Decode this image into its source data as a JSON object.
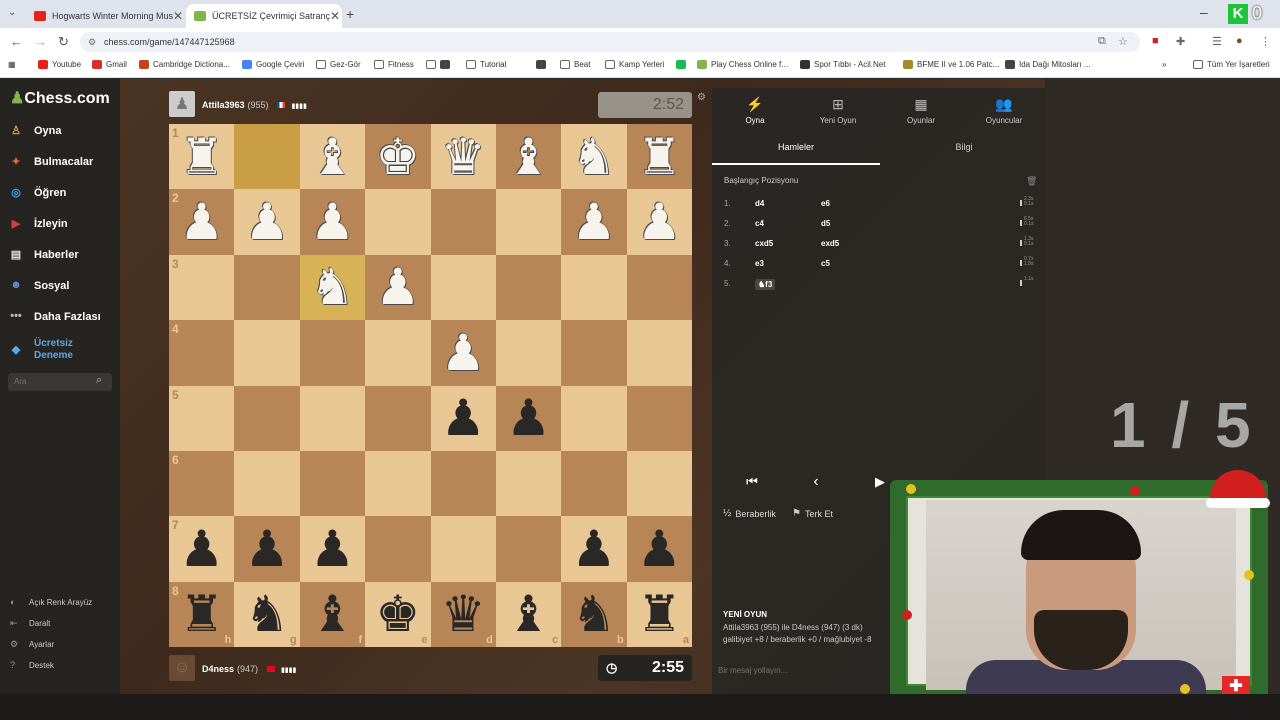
{
  "browser": {
    "tabs": [
      {
        "title": "Hogwarts Winter Morning Mus",
        "favicon_color": "#e62117",
        "active": false
      },
      {
        "title": "ÜCRETSİZ Çevrimiçi Satranç",
        "favicon_color": "#81b64c",
        "active": true
      }
    ],
    "url": "chess.com/game/147447125968",
    "bookmarks": [
      {
        "label": "Youtube",
        "icon": "youtube-icon",
        "color": "#e62117"
      },
      {
        "label": "Gmail",
        "icon": "gmail-icon",
        "color": "#d93025"
      },
      {
        "label": "Cambridge Dictiona...",
        "icon": "cambridge-icon",
        "color": "#c7421a"
      },
      {
        "label": "Google Çeviri",
        "icon": "translate-icon",
        "color": "#4285f4"
      },
      {
        "label": "Gez-Gör",
        "icon": "folder-icon",
        "color": ""
      },
      {
        "label": "Fitness",
        "icon": "folder-icon",
        "color": ""
      },
      {
        "label": "",
        "icon": "folder-icon",
        "color": ""
      },
      {
        "label": "",
        "icon": "music-icon",
        "color": "#444"
      },
      {
        "label": "Tutorial",
        "icon": "folder-icon",
        "color": ""
      },
      {
        "label": "",
        "icon": "gallery-icon",
        "color": "#444"
      },
      {
        "label": "Beat",
        "icon": "folder-icon",
        "color": ""
      },
      {
        "label": "Kamp Yerleri",
        "icon": "folder-icon",
        "color": ""
      },
      {
        "label": "",
        "icon": "spotify-icon",
        "color": "#1db954"
      },
      {
        "label": "Play Chess Online f...",
        "icon": "chess-icon",
        "color": "#81b64c"
      },
      {
        "label": "Spor Tıbbı - Acil.Net",
        "icon": "globe-icon",
        "color": "#333"
      },
      {
        "label": "BFME II ve 1.06 Patc...",
        "icon": "bfme-icon",
        "color": "#a38b2e"
      },
      {
        "label": "Ida Dağı Mitosları ...",
        "icon": "doc-icon",
        "color": "#444"
      }
    ],
    "bookmarks_more": "»",
    "all_bookmarks": "Tüm Yer İşaretleri"
  },
  "sidebar": {
    "logo": "Chess.com",
    "items": [
      {
        "label": "Oyna",
        "icon": "play-icon",
        "color": "#e0a04b"
      },
      {
        "label": "Bulmacalar",
        "icon": "puzzle-icon",
        "color": "#e06a3b"
      },
      {
        "label": "Öğren",
        "icon": "learn-icon",
        "color": "#3fa8e0"
      },
      {
        "label": "İzleyin",
        "icon": "watch-icon",
        "color": "#e03b3b"
      },
      {
        "label": "Haberler",
        "icon": "news-icon",
        "color": "#e0e0e0"
      },
      {
        "label": "Sosyal",
        "icon": "social-icon",
        "color": "#5a8fd6"
      },
      {
        "label": "Daha Fazlası",
        "icon": "more-icon",
        "color": "#bbb"
      }
    ],
    "trial": {
      "line1": "Ücretsiz",
      "line2": "Deneme"
    },
    "search_placeholder": "Ara",
    "bottom": [
      {
        "label": "Açık Renk Arayüz",
        "icon": "theme-icon"
      },
      {
        "label": "Daralt",
        "icon": "collapse-icon"
      },
      {
        "label": "Ayarlar",
        "icon": "settings-icon"
      },
      {
        "label": "Destek",
        "icon": "help-icon"
      }
    ]
  },
  "game": {
    "top_player": {
      "name": "Attila3963",
      "rating": "(955)",
      "clock": "2:52"
    },
    "bottom_player": {
      "name": "D4ness",
      "rating": "(947)",
      "clock": "2:55"
    },
    "board": [
      [
        "wR",
        "",
        "wB",
        "wK",
        "wQ",
        "wB",
        "wN",
        "wR"
      ],
      [
        "wP",
        "wP",
        "wP",
        "",
        "",
        "",
        "wP",
        "wP"
      ],
      [
        "",
        "",
        "wN",
        "wP",
        "",
        "",
        "",
        ""
      ],
      [
        "",
        "",
        "",
        "",
        "wP",
        "",
        "",
        ""
      ],
      [
        "",
        "",
        "",
        "",
        "bP",
        "bP",
        "",
        ""
      ],
      [
        "",
        "",
        "",
        "",
        "",
        "",
        "",
        ""
      ],
      [
        "bP",
        "bP",
        "bP",
        "",
        "",
        "",
        "bP",
        "bP"
      ],
      [
        "bR",
        "bN",
        "bB",
        "bK",
        "bQ",
        "bB",
        "bN",
        "bR"
      ]
    ],
    "highlight_squares": [
      [
        0,
        1
      ],
      [
        2,
        2
      ]
    ],
    "rank_labels": [
      "1",
      "2",
      "3",
      "4",
      "5",
      "6",
      "7",
      "8"
    ],
    "file_labels": [
      "h",
      "g",
      "f",
      "e",
      "d",
      "c",
      "b",
      "a"
    ]
  },
  "panel": {
    "tabs": [
      {
        "label": "Oyna",
        "icon": "lightning-icon",
        "active": true
      },
      {
        "label": "Yeni Oyun",
        "icon": "plus-icon",
        "active": false
      },
      {
        "label": "Oyunlar",
        "icon": "board-icon",
        "active": false
      },
      {
        "label": "Oyuncular",
        "icon": "players-icon",
        "active": false
      }
    ],
    "subtabs": [
      "Hamleler",
      "Bilgi"
    ],
    "start_position": "Başlangıç Pozisyonu",
    "moves": [
      {
        "num": "1.",
        "white": "d4",
        "black": "e6",
        "t1": "2.3s",
        "t2": "0.1s"
      },
      {
        "num": "2.",
        "white": "c4",
        "black": "d5",
        "t1": "6.5s",
        "t2": "0.1s"
      },
      {
        "num": "3.",
        "white": "cxd5",
        "black": "exd5",
        "t1": "1.3s",
        "t2": "0.1s"
      },
      {
        "num": "4.",
        "white": "e3",
        "black": "c5",
        "t1": "0.7s",
        "t2": "1.8s"
      },
      {
        "num": "5.",
        "white": "♞f3",
        "black": "",
        "t1": "1.1s",
        "t2": ""
      }
    ],
    "counter": "1 / 5",
    "nav": [
      "⏮",
      "‹",
      "▶"
    ],
    "draw_label": "Beraberlik",
    "resign_label": "Terk Et",
    "new_game": {
      "title": "YENİ OYUN",
      "line1": "Attila3963 (955) ile D4ness (947) (3 dk)",
      "line2": "galibiyet +8 / beraberlik +0 / mağlubiyet -8"
    },
    "chat_placeholder": "Bir mesaj yollayın..."
  },
  "colors": {
    "light_square": "#e9c794",
    "dark_square": "#b88656",
    "accent": "#81b64c"
  }
}
